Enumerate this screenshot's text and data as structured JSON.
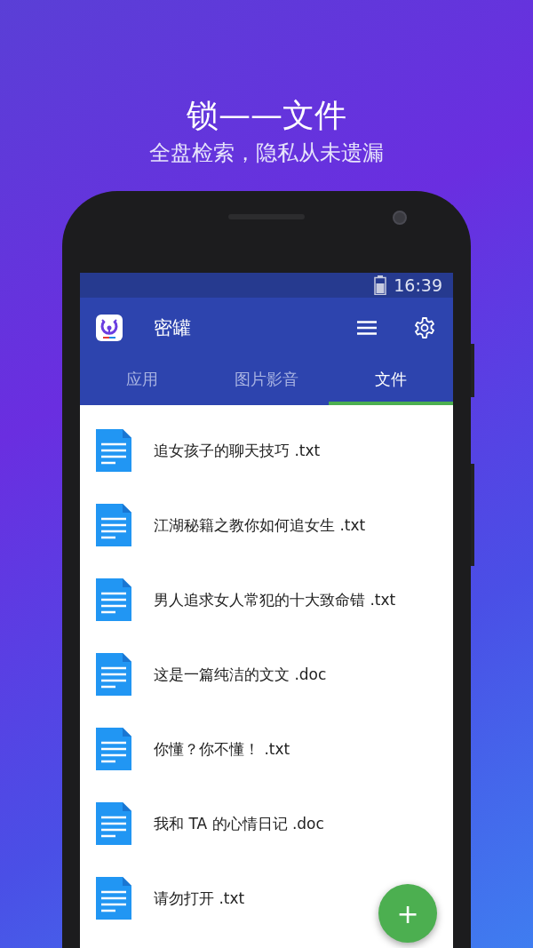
{
  "headline": "锁——文件",
  "subtitle": "全盘检索，隐私从未遗漏",
  "status_bar": {
    "time": "16:39"
  },
  "app_bar": {
    "title": "密罐"
  },
  "tabs": [
    {
      "label": "应用",
      "selected": false
    },
    {
      "label": "图片影音",
      "selected": false
    },
    {
      "label": "文件",
      "selected": true
    }
  ],
  "files": [
    {
      "name": "追女孩子的聊天技巧 .txt"
    },
    {
      "name": "江湖秘籍之教你如何追女生 .txt"
    },
    {
      "name": "男人追求女人常犯的十大致命错 .txt"
    },
    {
      "name": "这是一篇纯洁的文文 .doc"
    },
    {
      "name": "你懂？你不懂！ .txt"
    },
    {
      "name": "我和 TA 的心情日记 .doc"
    },
    {
      "name": "请勿打开 .txt"
    }
  ],
  "fab": {
    "label": "+"
  }
}
